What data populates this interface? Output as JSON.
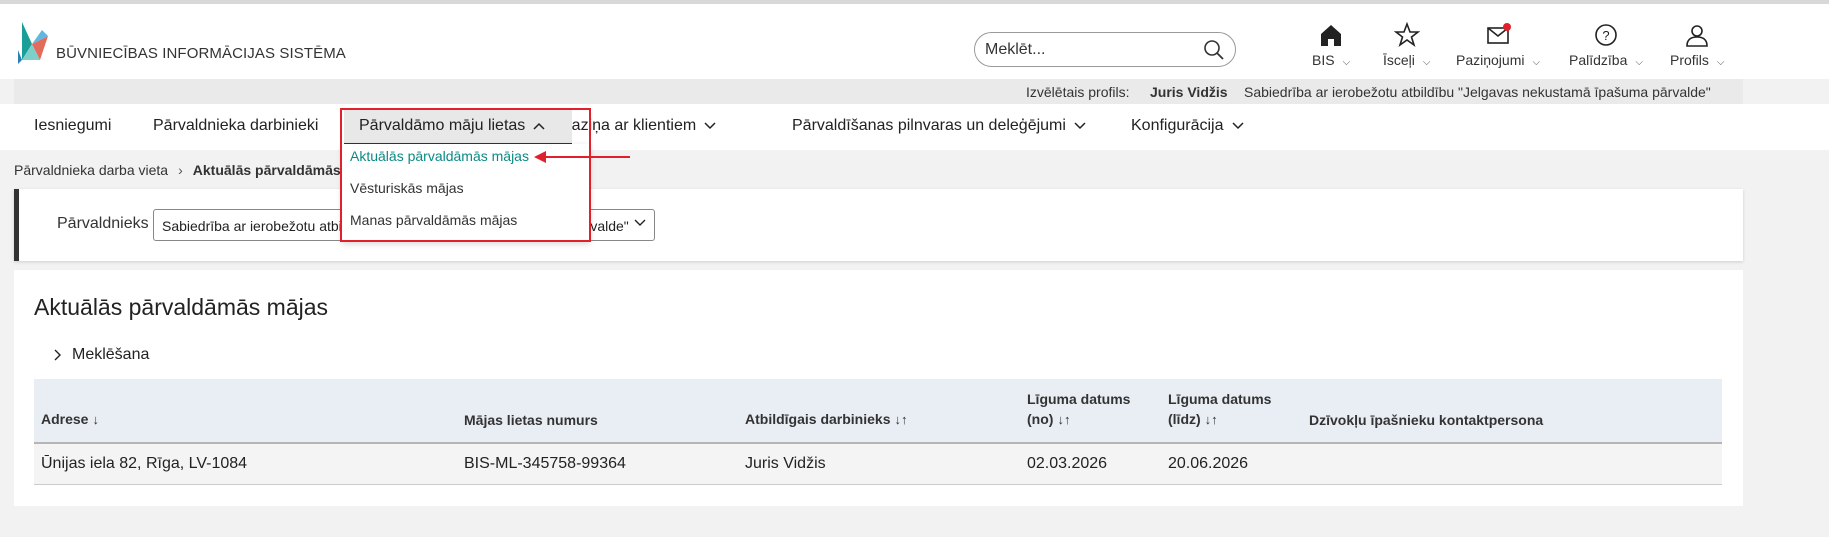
{
  "app": {
    "title": "BŪVNIECĪBAS INFORMĀCIJAS SISTĒMA",
    "brand_color": "#1a9e98"
  },
  "search": {
    "placeholder": "Meklēt..."
  },
  "topnav": [
    {
      "label": "BIS",
      "icon": "home-icon"
    },
    {
      "label": "Īsceļi",
      "icon": "star-icon"
    },
    {
      "label": "Paziņojumi",
      "icon": "envelope-icon"
    },
    {
      "label": "Palīdzība",
      "icon": "help-icon"
    },
    {
      "label": "Profils",
      "icon": "user-icon"
    }
  ],
  "profile_bar": {
    "label": "Izvēlētais profils:",
    "name": "Juris Vidžis",
    "organization": "Sabiedrība ar ierobežotu atbildību \"Jelgavas nekustamā īpašuma pārvalde\""
  },
  "mainnav": [
    {
      "label": "Iesniegumi"
    },
    {
      "label": "Pārvaldnieka darbinieki"
    },
    {
      "label": "Pārvaldāmo māju lietas"
    },
    {
      "label": "Saziņa ar klientiem"
    },
    {
      "label": "Pārvaldīšanas pilnvaras un deleģējumi"
    },
    {
      "label": "Konfigurācija"
    }
  ],
  "dropdown": {
    "items": [
      {
        "label": "Aktuālās pārvaldāmās mājas"
      },
      {
        "label": "Vēsturiskās mājas"
      },
      {
        "label": "Manas pārvaldāmās mājas"
      }
    ]
  },
  "breadcrumb": {
    "root": "Pārvaldnieka darba vieta",
    "current": "Aktuālās pārvaldāmās mājas"
  },
  "filter": {
    "label": "Pārvaldnieks",
    "value": "Sabiedrība ar ierobežotu atbildību \"Jelgavas nekustamā īpašuma pārvalde\""
  },
  "page": {
    "title": "Aktuālās pārvaldāmās mājas",
    "search_toggle": "Meklēšana"
  },
  "table": {
    "headers": {
      "address": "Adrese",
      "case_number": "Mājas lietas numurs",
      "employee": "Atbildīgais darbinieks",
      "date_from": "Līguma datums (no)",
      "date_to": "Līguma datums (līdz)",
      "contact": "Dzīvokļu īpašnieku kontaktpersona"
    },
    "sort_desc": "↓",
    "sort_both": "↓↑",
    "rows": [
      {
        "address": "Ūnijas iela 82, Rīga, LV-1084",
        "case_number": "BIS-ML-345758-99364",
        "employee": "Juris Vidžis",
        "date_from": "02.03.2026",
        "date_to": "20.06.2026",
        "contact": ""
      }
    ]
  },
  "annotation": {
    "highlight_color": "#e0202a"
  }
}
